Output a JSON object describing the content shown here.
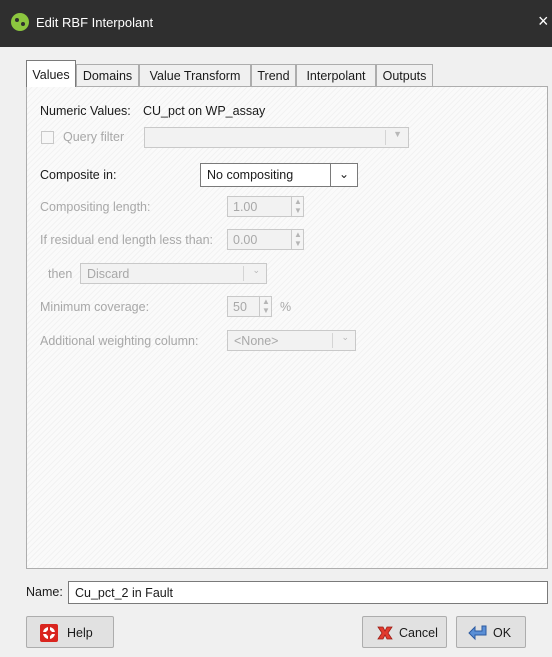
{
  "window": {
    "title": "Edit RBF Interpolant",
    "close_glyph": "×",
    "app_icon": "leapfrog-app-icon"
  },
  "tabs": [
    {
      "label": "Values",
      "active": true
    },
    {
      "label": "Domains",
      "active": false
    },
    {
      "label": "Value Transform",
      "active": false
    },
    {
      "label": "Trend",
      "active": false
    },
    {
      "label": "Interpolant",
      "active": false
    },
    {
      "label": "Outputs",
      "active": false
    }
  ],
  "values_tab": {
    "numeric_values_label": "Numeric Values:",
    "numeric_values_value": "CU_pct on WP_assay",
    "query_filter_label": "Query filter",
    "query_filter_value": "",
    "composite_in_label": "Composite in:",
    "composite_in_value": "No compositing",
    "compositing_length_label": "Compositing length:",
    "compositing_length_value": "1.00",
    "residual_label": "If residual end length less than:",
    "residual_value": "0.00",
    "then_label": "then",
    "then_value": "Discard",
    "min_coverage_label": "Minimum coverage:",
    "min_coverage_value": "50",
    "min_coverage_unit": "%",
    "weighting_label": "Additional weighting column:",
    "weighting_value": "<None>"
  },
  "footer": {
    "name_label": "Name:",
    "name_value": "Cu_pct_2 in Fault",
    "help_label": "Help",
    "cancel_label": "Cancel",
    "ok_label": "OK"
  },
  "colors": {
    "titlebar": "#2f2f2f",
    "dialog_bg": "#f0f0f0",
    "disabled_text": "#a8a8a8",
    "app_icon": "#8cc63f"
  }
}
